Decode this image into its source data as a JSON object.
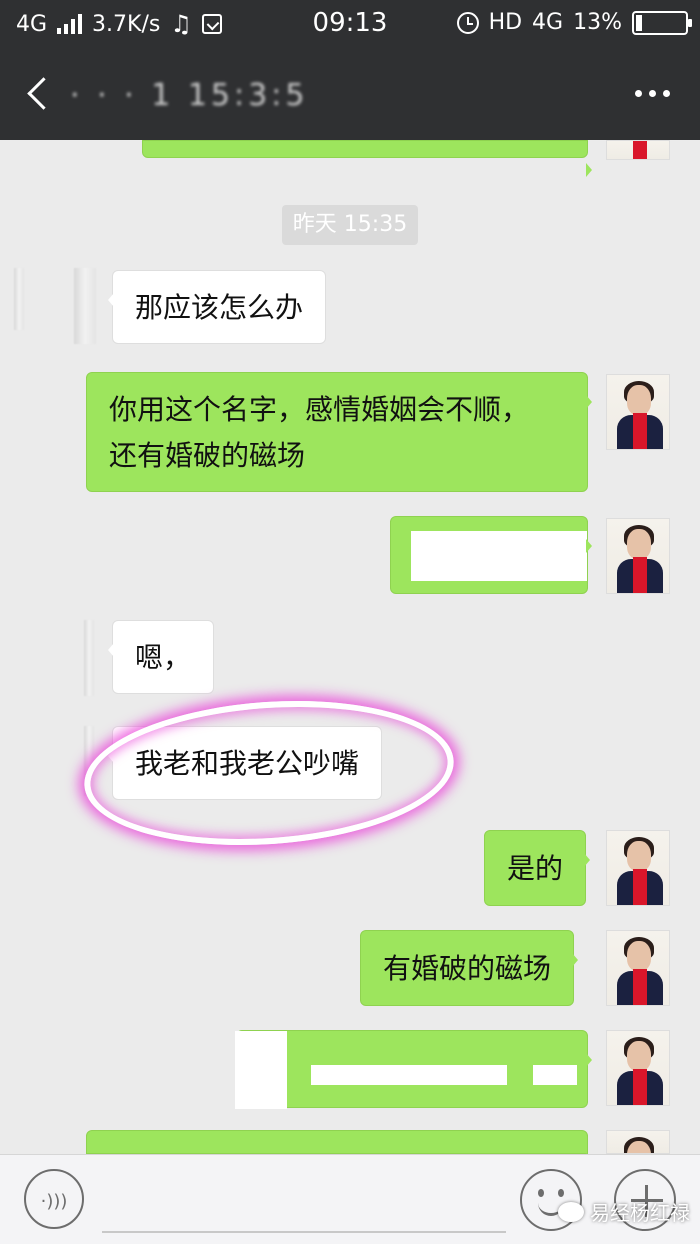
{
  "status_bar": {
    "network": "4G",
    "speed": "3.7K/s",
    "time": "09:13",
    "hd": "HD",
    "network_right": "4G",
    "battery": "13%"
  },
  "header": {
    "title": "· · · 1   15:3:5"
  },
  "chat": {
    "timestamp": "昨天 15:35",
    "messages": [
      {
        "from": "other",
        "text": "那应该怎么办"
      },
      {
        "from": "me",
        "line1": "你用这个名字，感情婚姻会不顺，",
        "line2": "还有婚破的磁场"
      },
      {
        "from": "other",
        "text": "嗯，"
      },
      {
        "from": "other",
        "text": "我老和我老公吵嘴"
      },
      {
        "from": "me",
        "text": "是的"
      },
      {
        "from": "me",
        "text": "有婚破的磁场"
      }
    ]
  },
  "input_bar": {
    "input_value": "",
    "voice_icon": "·)))"
  },
  "watermark": {
    "text": "易经杨红禄"
  },
  "colors": {
    "header_bg": "#2f3032",
    "chat_bg": "#ebebeb",
    "green_bubble": "#9de55d",
    "highlight": "#e940d8"
  }
}
